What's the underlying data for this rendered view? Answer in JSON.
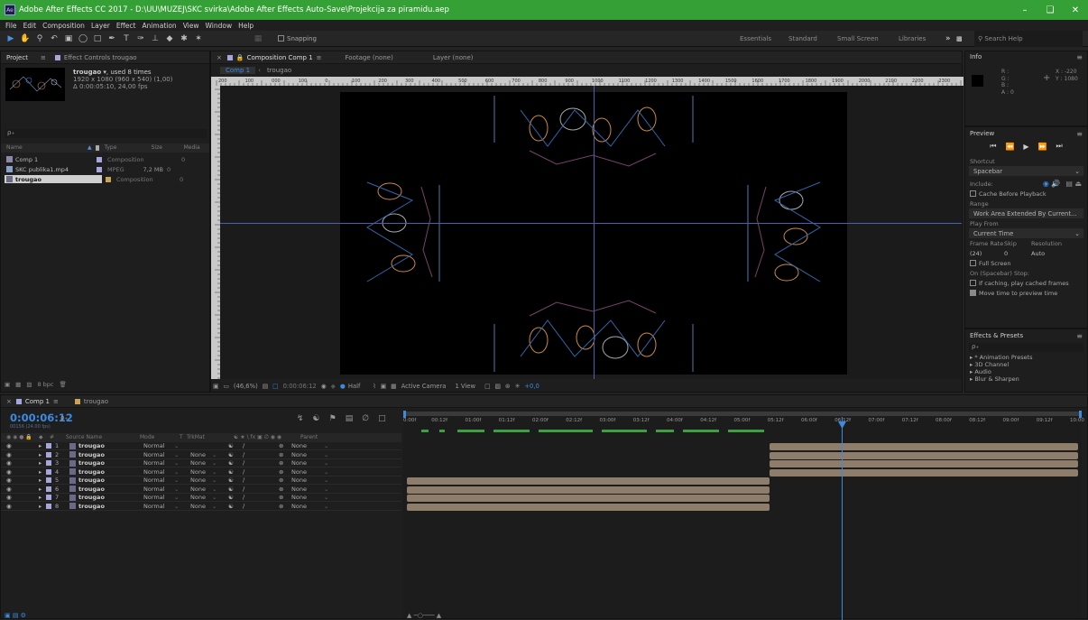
{
  "title": "Adobe After Effects CC 2017 - D:\\UU\\MUZEJ\\SKC svirka\\Adobe After Effects Auto-Save\\Projekcija za piramidu.aep",
  "app_icon": "Ae",
  "window_controls": [
    "minimize-icon",
    "restore-icon",
    "close-icon"
  ],
  "menu": [
    "File",
    "Edit",
    "Composition",
    "Layer",
    "Effect",
    "Animation",
    "View",
    "Window",
    "Help"
  ],
  "toolbar": {
    "snapping": "Snapping",
    "workspaces": [
      "Essentials",
      "Standard",
      "Small Screen",
      "Libraries"
    ],
    "more": "»",
    "search_placeholder": "Search Help"
  },
  "project": {
    "tab_project": "Project",
    "tab_effects": "Effect Controls trougao",
    "item_name": "trougao",
    "used": ", used 8 times",
    "dims": "1920 x 1080  (960 x 540) (1,00)",
    "duration": "Δ 0:00:05:10, 24,00 fps",
    "search_placeholder": "ρ₊",
    "columns": [
      "Name",
      "Type",
      "Size",
      "Media"
    ],
    "items": [
      {
        "name": "Comp 1",
        "type": "Composition",
        "size": "",
        "media": "0"
      },
      {
        "name": "SKC publika1.mp4",
        "type": "MPEG",
        "size": "7,2 MB",
        "media": "0"
      },
      {
        "name": "trougao",
        "type": "Composition",
        "size": "",
        "media": "0"
      }
    ],
    "bpc": "8 bpc"
  },
  "comp": {
    "tab_comp": "Composition Comp 1",
    "tab_footage": "Footage (none)",
    "tab_layer": "Layer (none)",
    "breadcrumb": [
      "Comp 1",
      "trougao"
    ],
    "ruler": [
      "200",
      "100",
      "000",
      "100",
      "0",
      "100",
      "200",
      "300",
      "400",
      "500",
      "600",
      "700",
      "800",
      "900",
      "1000",
      "1100",
      "1200",
      "1300",
      "1400",
      "1500",
      "1600",
      "1700",
      "1800",
      "1900",
      "2000",
      "2100",
      "2200",
      "2300"
    ],
    "zoom": "(46,6%)",
    "timecode": "0:00:06:12",
    "resolution": "Half",
    "camera": "Active Camera",
    "view": "1 View",
    "exposure": "+0,0"
  },
  "info": {
    "title": "Info",
    "r": "R :",
    "g": "G :",
    "b": "B :",
    "a": "A : 0",
    "x": "X : -220",
    "y": "Y : 1080"
  },
  "preview": {
    "title": "Preview",
    "shortcut_label": "Shortcut",
    "shortcut_value": "Spacebar",
    "include_label": "Include:",
    "cache_before": "Cache Before Playback",
    "range_label": "Range",
    "range_value": "Work Area Extended By Current...",
    "play_from_label": "Play From",
    "play_from_value": "Current Time",
    "frame_rate_label": "Frame Rate",
    "skip_label": "Skip",
    "resolution_label": "Resolution",
    "frame_rate_value": "(24)",
    "skip_value": "0",
    "resolution_value": "Auto",
    "full_screen": "Full Screen",
    "on_stop": "On (Spacebar) Stop:",
    "if_caching": "If caching, play cached frames",
    "move_time": "Move time to preview time"
  },
  "effects": {
    "title": "Effects & Presets",
    "search_placeholder": "ρ₊",
    "items": [
      "* Animation Presets",
      "3D Channel",
      "Audio",
      "Blur & Sharpen"
    ]
  },
  "timeline": {
    "tab_comp": "Comp 1",
    "tab_trougao": "trougao",
    "timecode": "0:00:06:12",
    "fps_sub": "00156 (24.00 fps)",
    "search_placeholder": "ρ₊",
    "columns": {
      "num": "#",
      "source": "Source Name",
      "mode": "Mode",
      "t": "T",
      "trkmat": "TrkMat",
      "parent": "Parent"
    },
    "time_marks": [
      "0:00f",
      "00:12f",
      "01:00f",
      "01:12f",
      "02:00f",
      "02:12f",
      "03:00f",
      "03:12f",
      "04:00f",
      "04:12f",
      "05:00f",
      "05:12f",
      "06:00f",
      "06:12f",
      "07:00f",
      "07:12f",
      "08:00f",
      "08:12f",
      "09:00f",
      "09:12f",
      "10:00"
    ],
    "layers": [
      {
        "num": "1",
        "name": "trougao",
        "mode": "Normal",
        "trkmat": "",
        "parent": "None"
      },
      {
        "num": "2",
        "name": "trougao",
        "mode": "Normal",
        "trkmat": "None",
        "parent": "None"
      },
      {
        "num": "3",
        "name": "trougao",
        "mode": "Normal",
        "trkmat": "None",
        "parent": "None"
      },
      {
        "num": "4",
        "name": "trougao",
        "mode": "Normal",
        "trkmat": "None",
        "parent": "None"
      },
      {
        "num": "5",
        "name": "trougao",
        "mode": "Normal",
        "trkmat": "None",
        "parent": "None"
      },
      {
        "num": "6",
        "name": "trougao",
        "mode": "Normal",
        "trkmat": "None",
        "parent": "None"
      },
      {
        "num": "7",
        "name": "trougao",
        "mode": "Normal",
        "trkmat": "None",
        "parent": "None"
      },
      {
        "num": "8",
        "name": "trougao",
        "mode": "Normal",
        "trkmat": "None",
        "parent": "None"
      }
    ]
  },
  "colors": {
    "titlebar": "#35a035",
    "accent_blue": "#3b8be0",
    "layer_label": "#a6a6dc",
    "bar": "#8e7d6a"
  }
}
